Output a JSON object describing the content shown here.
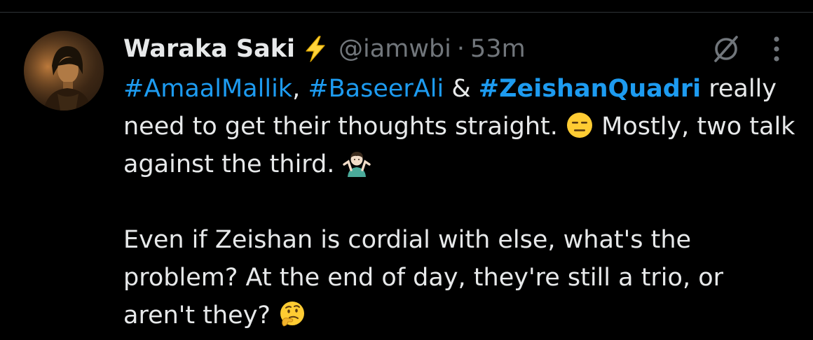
{
  "tweet": {
    "author": {
      "display_name": "Waraka Saki",
      "badge_icon": "lightning-bolt-icon",
      "handle": "@iamwbi",
      "separator": "·",
      "timestamp": "53m"
    },
    "actions": {
      "grok_icon": "grok-icon",
      "more_icon": "more-options-icon"
    },
    "body": {
      "line1": {
        "hashtag1": "#AmaalMallik",
        "joiner1": ", ",
        "hashtag2": "#BaseerAli",
        "joiner2": " & ",
        "hashtag3": "#ZeishanQuadri",
        "text": " really need to get their thoughts straight. ",
        "emoji1": "expressionless-face-emoji",
        "text2": " Mostly, two talk against the third. ",
        "emoji2": "person-shrugging-emoji"
      },
      "paragraph2": {
        "text": "Even if Zeishan is cordial with else, what's the problem? At the end of day, they're still a trio, or aren't they? ",
        "emoji": "thinking-face-emoji"
      }
    }
  },
  "colors": {
    "background": "#000000",
    "text_primary": "#e7e9ea",
    "text_secondary": "#71767b",
    "link": "#1d9bf0",
    "bolt": "#ffd43b"
  }
}
